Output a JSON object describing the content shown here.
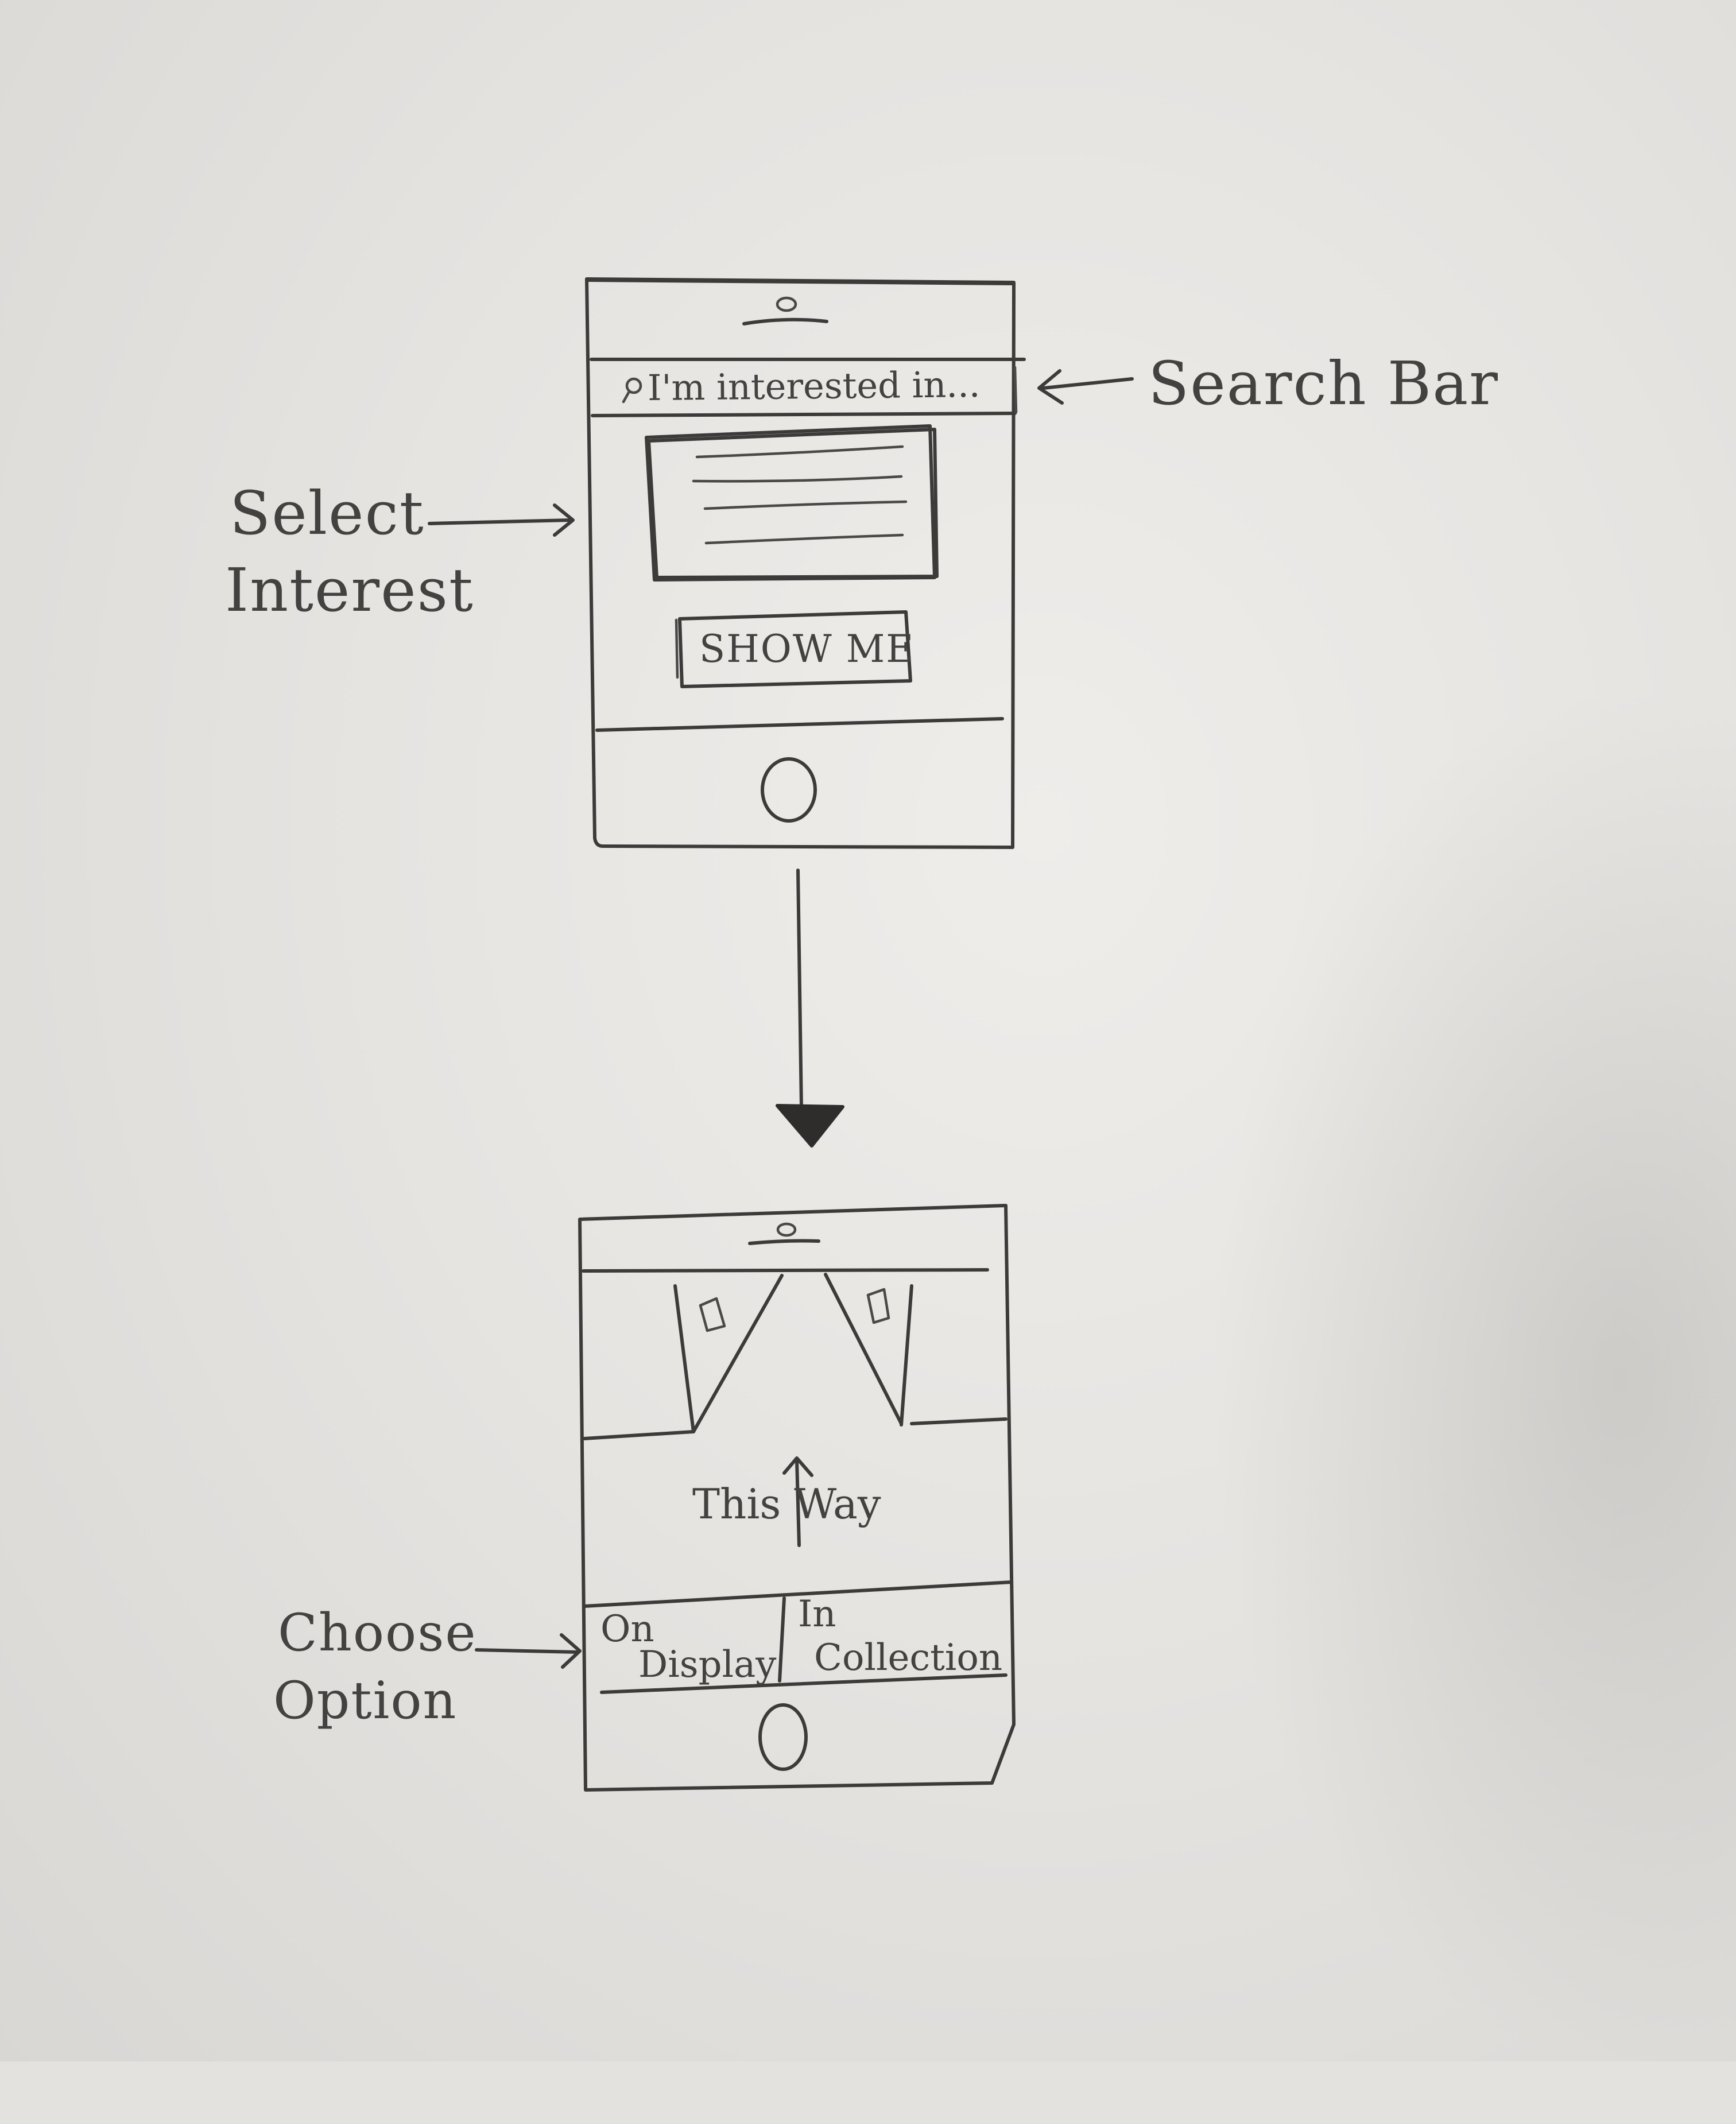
{
  "annotations": {
    "search_bar": "Search Bar",
    "select_interest_line1": "Select",
    "select_interest_line2": "Interest",
    "choose_option_line1": "Choose",
    "choose_option_line2": "Option"
  },
  "screen1": {
    "search_placeholder": "I'm interested in...",
    "show_me_button": "SHOW ME"
  },
  "screen2": {
    "direction_label": "This Way",
    "option_on_display_line1": "On",
    "option_on_display_line2": "Display",
    "option_in_collection_line1": "In",
    "option_in_collection_line2": "Collection"
  },
  "icons": [
    "search-icon",
    "camera-icon",
    "home-button-icon",
    "up-arrow-icon",
    "flow-arrow-icon"
  ],
  "colors": {
    "pencil": "#3c3b3a",
    "paper": "#e4e2df"
  }
}
